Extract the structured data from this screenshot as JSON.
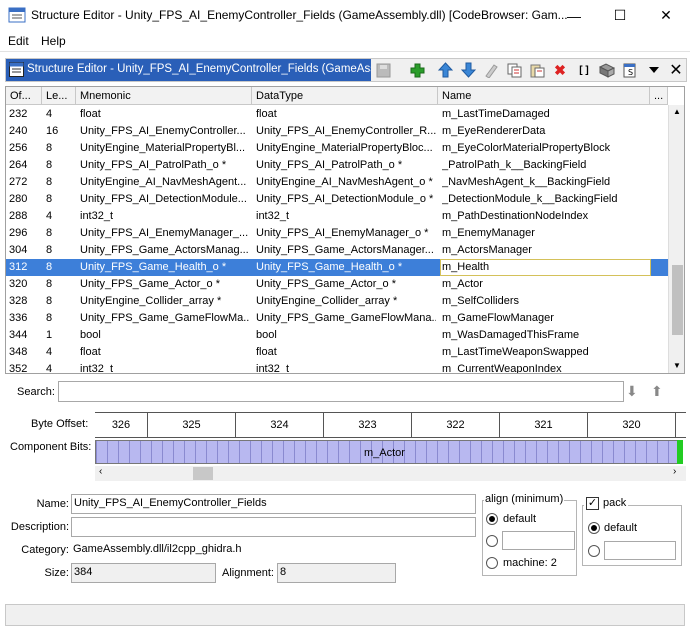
{
  "window": {
    "title": "Structure Editor - Unity_FPS_AI_EnemyController_Fields (GameAssembly.dll) [CodeBrowser: Gam...",
    "minimize": "—",
    "maximize": "☐",
    "close": "✕"
  },
  "menu": {
    "edit": "Edit",
    "help": "Help"
  },
  "panel": {
    "tab_title": "Structure Editor - Unity_FPS_AI_EnemyController_Fields (GameAsse...",
    "tools": [
      "save-icon",
      "add-icon",
      "move-up-icon",
      "move-down-icon",
      "duplicate-icon",
      "copy-icon",
      "paste-icon",
      "delete-icon",
      "array-icon",
      "pointer-icon",
      "unpack-icon",
      "dropdown-icon",
      "close-icon"
    ]
  },
  "table": {
    "headers": [
      "Of...",
      "Le...",
      "Mnemonic",
      "DataType",
      "Name",
      "..."
    ],
    "rows": [
      {
        "offset": "232",
        "length": "4",
        "mnemonic": "float",
        "datatype": "float",
        "name": "m_LastTimeDamaged"
      },
      {
        "offset": "240",
        "length": "16",
        "mnemonic": "Unity_FPS_AI_EnemyController...",
        "datatype": "Unity_FPS_AI_EnemyController_R...",
        "name": "m_EyeRendererData"
      },
      {
        "offset": "256",
        "length": "8",
        "mnemonic": "UnityEngine_MaterialPropertyBl...",
        "datatype": "UnityEngine_MaterialPropertyBloc...",
        "name": "m_EyeColorMaterialPropertyBlock"
      },
      {
        "offset": "264",
        "length": "8",
        "mnemonic": "Unity_FPS_AI_PatrolPath_o *",
        "datatype": "Unity_FPS_AI_PatrolPath_o *",
        "name": "_PatrolPath_k__BackingField"
      },
      {
        "offset": "272",
        "length": "8",
        "mnemonic": "UnityEngine_AI_NavMeshAgent...",
        "datatype": "UnityEngine_AI_NavMeshAgent_o *",
        "name": "_NavMeshAgent_k__BackingField"
      },
      {
        "offset": "280",
        "length": "8",
        "mnemonic": "Unity_FPS_AI_DetectionModule...",
        "datatype": "Unity_FPS_AI_DetectionModule_o *",
        "name": "_DetectionModule_k__BackingField"
      },
      {
        "offset": "288",
        "length": "4",
        "mnemonic": "int32_t",
        "datatype": "int32_t",
        "name": "m_PathDestinationNodeIndex"
      },
      {
        "offset": "296",
        "length": "8",
        "mnemonic": "Unity_FPS_AI_EnemyManager_...",
        "datatype": "Unity_FPS_AI_EnemyManager_o *",
        "name": "m_EnemyManager"
      },
      {
        "offset": "304",
        "length": "8",
        "mnemonic": "Unity_FPS_Game_ActorsManag...",
        "datatype": "Unity_FPS_Game_ActorsManager...",
        "name": "m_ActorsManager"
      },
      {
        "offset": "312",
        "length": "8",
        "mnemonic": "Unity_FPS_Game_Health_o *",
        "datatype": "Unity_FPS_Game_Health_o *",
        "name": "m_Health",
        "selected": true
      },
      {
        "offset": "320",
        "length": "8",
        "mnemonic": "Unity_FPS_Game_Actor_o *",
        "datatype": "Unity_FPS_Game_Actor_o *",
        "name": "m_Actor"
      },
      {
        "offset": "328",
        "length": "8",
        "mnemonic": "UnityEngine_Collider_array *",
        "datatype": "UnityEngine_Collider_array *",
        "name": "m_SelfColliders"
      },
      {
        "offset": "336",
        "length": "8",
        "mnemonic": "Unity_FPS_Game_GameFlowMa...",
        "datatype": "Unity_FPS_Game_GameFlowMana...",
        "name": "m_GameFlowManager"
      },
      {
        "offset": "344",
        "length": "1",
        "mnemonic": "bool",
        "datatype": "bool",
        "name": "m_WasDamagedThisFrame"
      },
      {
        "offset": "348",
        "length": "4",
        "mnemonic": "float",
        "datatype": "float",
        "name": "m_LastTimeWeaponSwapped"
      },
      {
        "offset": "352",
        "length": "4",
        "mnemonic": "int32_t",
        "datatype": "int32_t",
        "name": "m_CurrentWeaponIndex"
      }
    ]
  },
  "search": {
    "label": "Search:",
    "value": ""
  },
  "bitview": {
    "byte_offset_label": "Byte Offset:",
    "component_bits_label": "Component Bits:",
    "offsets": [
      "326",
      "325",
      "324",
      "323",
      "322",
      "321",
      "320"
    ],
    "component_name": "m_Actor"
  },
  "form": {
    "name_label": "Name:",
    "name_value": "Unity_FPS_AI_EnemyController_Fields",
    "description_label": "Description:",
    "description_value": "",
    "category_label": "Category:",
    "category_value": "GameAssembly.dll/il2cpp_ghidra.h",
    "size_label": "Size:",
    "size_value": "384",
    "alignment_label": "Alignment:",
    "alignment_value": "8",
    "align_group_label": "align (minimum)",
    "align_default": "default",
    "align_custom_value": "",
    "align_machine": "machine: 2",
    "pack_label": "pack",
    "pack_default": "default",
    "pack_custom_value": ""
  },
  "colors": {
    "selection": "#3d7fd9",
    "tab": "#2a5fb8",
    "bits": "#b8b8f0",
    "bit_marker": "#22cc22"
  }
}
